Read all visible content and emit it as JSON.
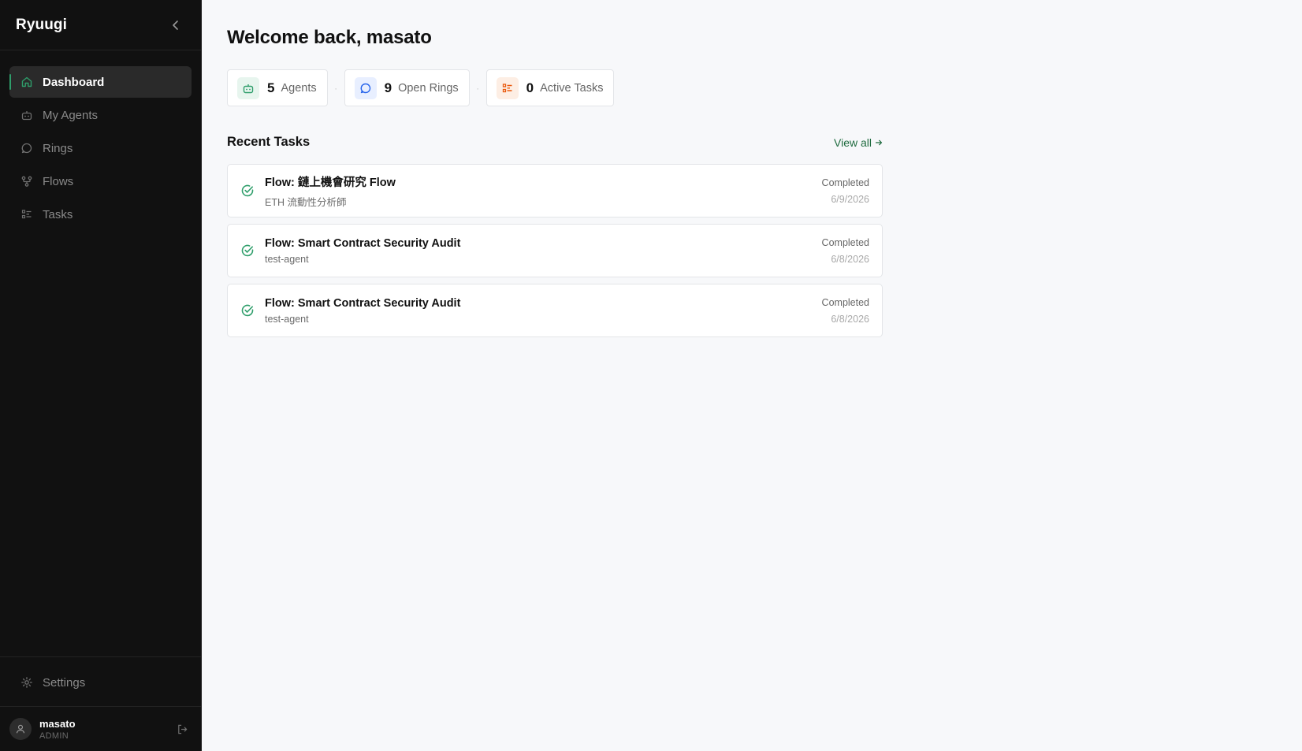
{
  "sidebar": {
    "brand": "Ryuugi",
    "nav": [
      {
        "label": "Dashboard",
        "icon": "home-icon",
        "active": true
      },
      {
        "label": "My Agents",
        "icon": "robot-icon"
      },
      {
        "label": "Rings",
        "icon": "chat-bubble-icon"
      },
      {
        "label": "Flows",
        "icon": "flow-icon"
      },
      {
        "label": "Tasks",
        "icon": "task-list-icon"
      }
    ],
    "settings_label": "Settings",
    "user": {
      "name": "masato",
      "role": "ADMIN"
    }
  },
  "main": {
    "title": "Welcome back, masato",
    "stats": [
      {
        "value": "5",
        "label": "Agents",
        "icon": "robot-icon",
        "color": "#2f9e6b"
      },
      {
        "value": "9",
        "label": "Open Rings",
        "icon": "chat-bubble-icon",
        "color": "#2563eb"
      },
      {
        "value": "0",
        "label": "Active Tasks",
        "icon": "task-list-icon",
        "color": "#ea580c"
      }
    ],
    "recent_tasks_title": "Recent Tasks",
    "view_all": "View all",
    "tasks": [
      {
        "title": "Flow: 鏈上機會研究 Flow",
        "subtitle": "ETH 流動性分析師",
        "status": "Completed",
        "date": "6/9/2026"
      },
      {
        "title": "Flow: Smart Contract Security Audit",
        "subtitle": "test-agent",
        "status": "Completed",
        "date": "6/8/2026"
      },
      {
        "title": "Flow: Smart Contract Security Audit",
        "subtitle": "test-agent",
        "status": "Completed",
        "date": "6/8/2026"
      }
    ]
  },
  "colors": {
    "accent": "#2f9e6b",
    "sidebar_bg": "#111111",
    "main_bg": "#f7f8fa"
  }
}
